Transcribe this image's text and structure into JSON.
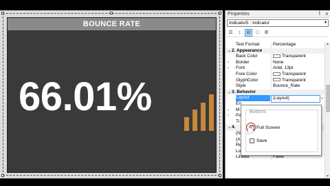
{
  "indicator": {
    "header": "BOUNCE RATE",
    "value": "66.01%",
    "bar_levels": [
      0.38,
      0.58,
      0.78,
      1.0
    ],
    "colors": {
      "background": "#3a3a3a",
      "header": "#8a8a8a",
      "bars": "#c7873a"
    }
  },
  "properties": {
    "title": "Properties",
    "pin_icon": "pin-icon",
    "close_label": "x",
    "object_selector": "Indicator5 : Indicator",
    "toolbar": [
      "categorized-icon",
      "alphabetical-icon",
      "properties-icon",
      "events-icon",
      "settings-icon"
    ],
    "rows": [
      {
        "name": "Text Format",
        "value": "Percentage",
        "type": "prop"
      },
      {
        "name": "2. Appearance",
        "value": "",
        "type": "cat",
        "exp": "⌄"
      },
      {
        "name": "Back Color",
        "value": "Transparent",
        "type": "color"
      },
      {
        "name": "Border",
        "value": "None",
        "type": "prop",
        "exp": "›"
      },
      {
        "name": "Font",
        "value": "Arial, 13pt",
        "type": "prop",
        "exp": "›"
      },
      {
        "name": "Fore Color",
        "value": "Transparent",
        "type": "color"
      },
      {
        "name": "GlyphColor",
        "value": "Transparent",
        "type": "color"
      },
      {
        "name": "Style",
        "value": "Bounce_Rate",
        "type": "prop"
      },
      {
        "name": "3. Behavior",
        "value": "",
        "type": "cat",
        "exp": "⌄"
      },
      {
        "name": "Layout",
        "value": "(Layout)",
        "type": "sel"
      },
      {
        "name": "En",
        "value": "",
        "type": "prop"
      },
      {
        "name": "M",
        "value": "",
        "type": "prop",
        "exp": "›"
      },
      {
        "name": "Pa",
        "value": "",
        "type": "prop",
        "exp": "›"
      },
      {
        "name": "Ti",
        "value": "",
        "type": "prop"
      },
      {
        "name": "4.",
        "value": "",
        "type": "cat",
        "exp": "⌄"
      },
      {
        "name": "(N",
        "value": "",
        "type": "prop"
      },
      {
        "name": "(A",
        "value": "",
        "type": "prop"
      },
      {
        "name": "Re",
        "value": "",
        "type": "prop"
      },
      {
        "name": "Locked",
        "value": "False",
        "type": "prop"
      },
      {
        "name": "Linked",
        "value": "False",
        "type": "prop"
      }
    ]
  },
  "layout_popup": {
    "group_label": "Buttons",
    "options": [
      {
        "label": "Full Screen",
        "checked": true
      },
      {
        "label": "Save",
        "checked": false
      }
    ]
  }
}
